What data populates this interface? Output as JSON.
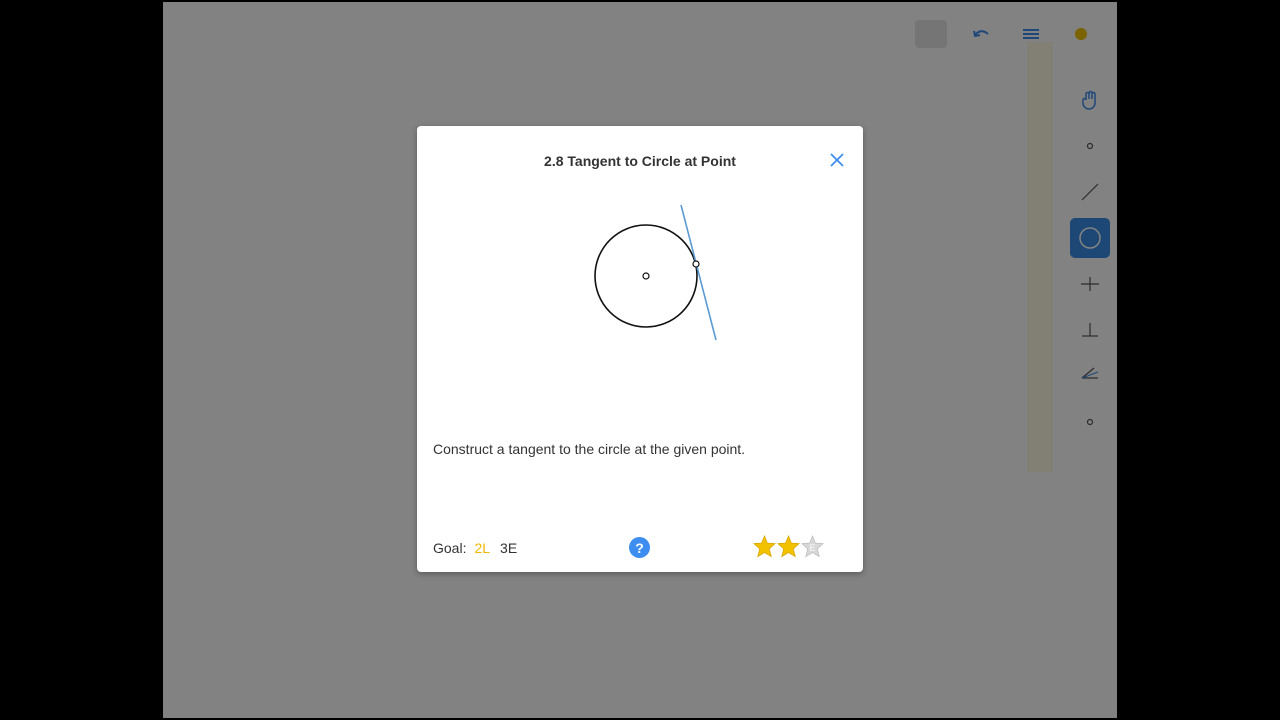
{
  "dialog": {
    "title": "2.8 Tangent to Circle at Point",
    "description": "Construct a tangent to the circle at the given point.",
    "goal_label": "Goal:",
    "goal_l": "2L",
    "goal_e": "3E",
    "help_symbol": "?",
    "stars": {
      "earned": 2,
      "total": 3,
      "empty_star_letter": "E"
    }
  },
  "colors": {
    "accent_blue": "#3d8ef0",
    "tangent_line": "#5b9bd5",
    "star_gold": "#f2c200",
    "goal_l": "#f2b705"
  },
  "icons": {
    "close": "close-icon",
    "help": "question-icon",
    "hand": "hand-icon",
    "point": "point-tool-icon",
    "line": "line-tool-icon",
    "circle": "circle-tool-icon",
    "perpendicular-bisector": "perpendicular-bisector-icon",
    "perpendicular": "perpendicular-icon",
    "angle-bisector": "angle-bisector-icon",
    "intersect": "intersect-icon",
    "undo": "undo-icon",
    "menu": "menu-icon",
    "hint": "hint-icon"
  }
}
